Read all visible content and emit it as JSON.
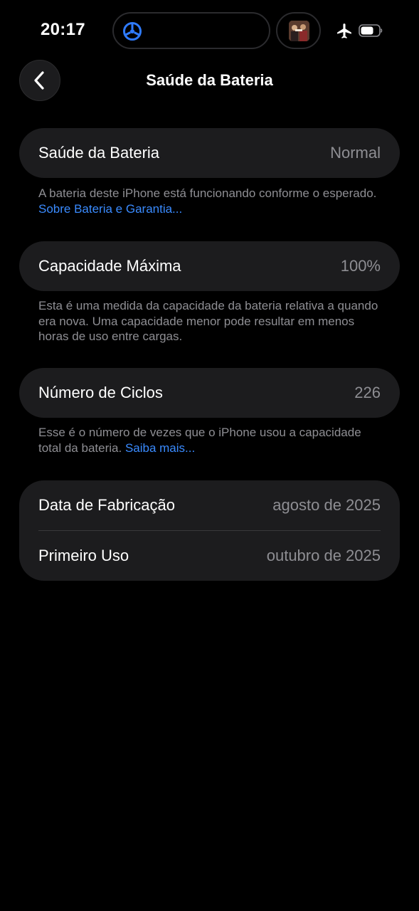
{
  "status_bar": {
    "time": "20:17"
  },
  "nav": {
    "title": "Saúde da Bateria"
  },
  "sections": [
    {
      "label": "Saúde da Bateria",
      "value": "Normal",
      "footnote": "A bateria deste iPhone está funcionando conforme o esperado.",
      "footnote_link": "Sobre Bateria e Garantia..."
    },
    {
      "label": "Capacidade Máxima",
      "value": "100%",
      "footnote": "Esta é uma medida da capacidade da bateria relativa a quando era nova. Uma capacidade menor pode resultar em menos horas de uso entre cargas."
    },
    {
      "label": "Número de Ciclos",
      "value": "226",
      "footnote": "Esse é o número de vezes que o iPhone usou a capacidade total da bateria.",
      "footnote_link": "Saiba mais..."
    }
  ],
  "dates": {
    "manufacture_label": "Data de Fabricação",
    "manufacture_value": "agosto de 2025",
    "first_use_label": "Primeiro Uso",
    "first_use_value": "outubro de 2025"
  },
  "icons": {
    "back": "chevron-left-icon",
    "airplane": "airplane-icon",
    "battery": "battery-icon",
    "island_app": "steering-wheel-icon"
  },
  "colors": {
    "background": "#000000",
    "card": "#1c1c1e",
    "link": "#3a8bff",
    "secondary_text": "#8e8e93"
  }
}
